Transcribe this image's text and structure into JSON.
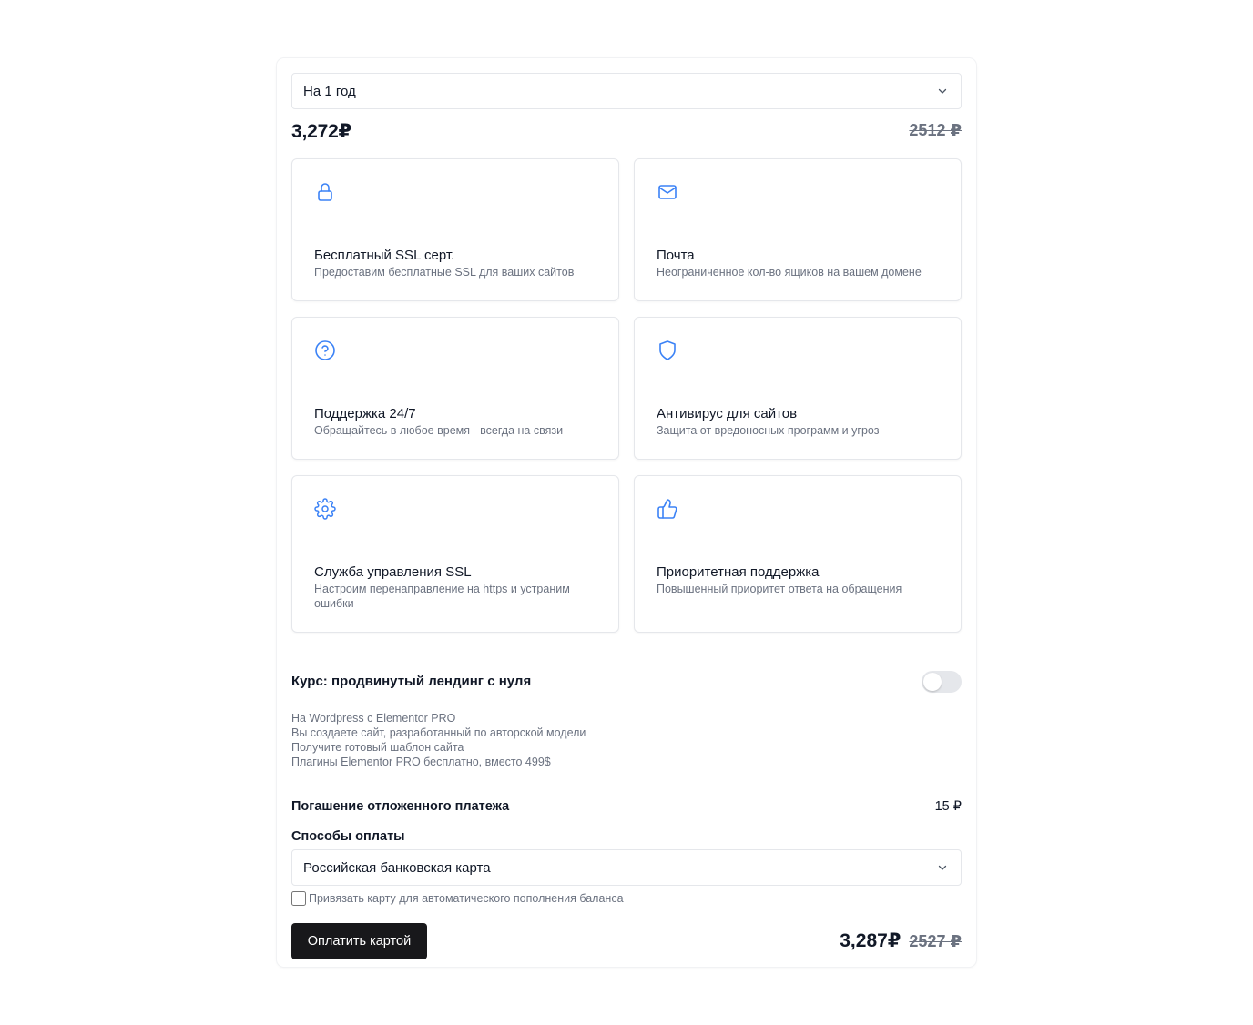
{
  "period_select": {
    "value": "На 1 год"
  },
  "price": {
    "current": "3,272₽",
    "old": "2512 ₽"
  },
  "features": [
    {
      "icon": "lock-icon",
      "title": "Бесплатный SSL серт.",
      "desc": "Предоставим бесплатные SSL для ваших сайтов"
    },
    {
      "icon": "mail-icon",
      "title": "Почта",
      "desc": "Неограниченное кол-во ящиков на вашем домене"
    },
    {
      "icon": "help-circle-icon",
      "title": "Поддержка 24/7",
      "desc": "Обращайтесь в любое время - всегда на связи"
    },
    {
      "icon": "shield-icon",
      "title": "Антивирус для сайтов",
      "desc": "Защита от вредоносных программ и угроз"
    },
    {
      "icon": "gear-icon",
      "title": "Служба управления SSL",
      "desc": "Настроим перенаправление на https и устраним ошибки"
    },
    {
      "icon": "thumbs-up-icon",
      "title": "Приоритетная поддержка",
      "desc": "Повышенный приоритет ответа на обращения"
    }
  ],
  "course": {
    "title": "Курс: продвинутый лендинг с нуля",
    "enabled": false,
    "lines": [
      "На Wordpress с Elementor PRO",
      "Вы создаете сайт, разработанный по авторской модели",
      "Получите готовый шаблон сайта",
      "Плагины Elementor PRO бесплатно, вместо 499$"
    ]
  },
  "deferred": {
    "label": "Погашение отложенного платежа",
    "value": "15 ₽"
  },
  "payment": {
    "label": "Способы оплаты",
    "method": "Российская банковская карта",
    "autobind_label": "Привязать карту для автоматического пополнения баланса",
    "autobind_checked": false
  },
  "footer": {
    "pay_button": "Оплатить картой",
    "total": "3,287₽",
    "total_old": "2527 ₽"
  },
  "colors": {
    "accent": "#3b82f6",
    "button_bg": "#18181b",
    "muted": "#6b7280",
    "border": "#e5e7eb"
  }
}
